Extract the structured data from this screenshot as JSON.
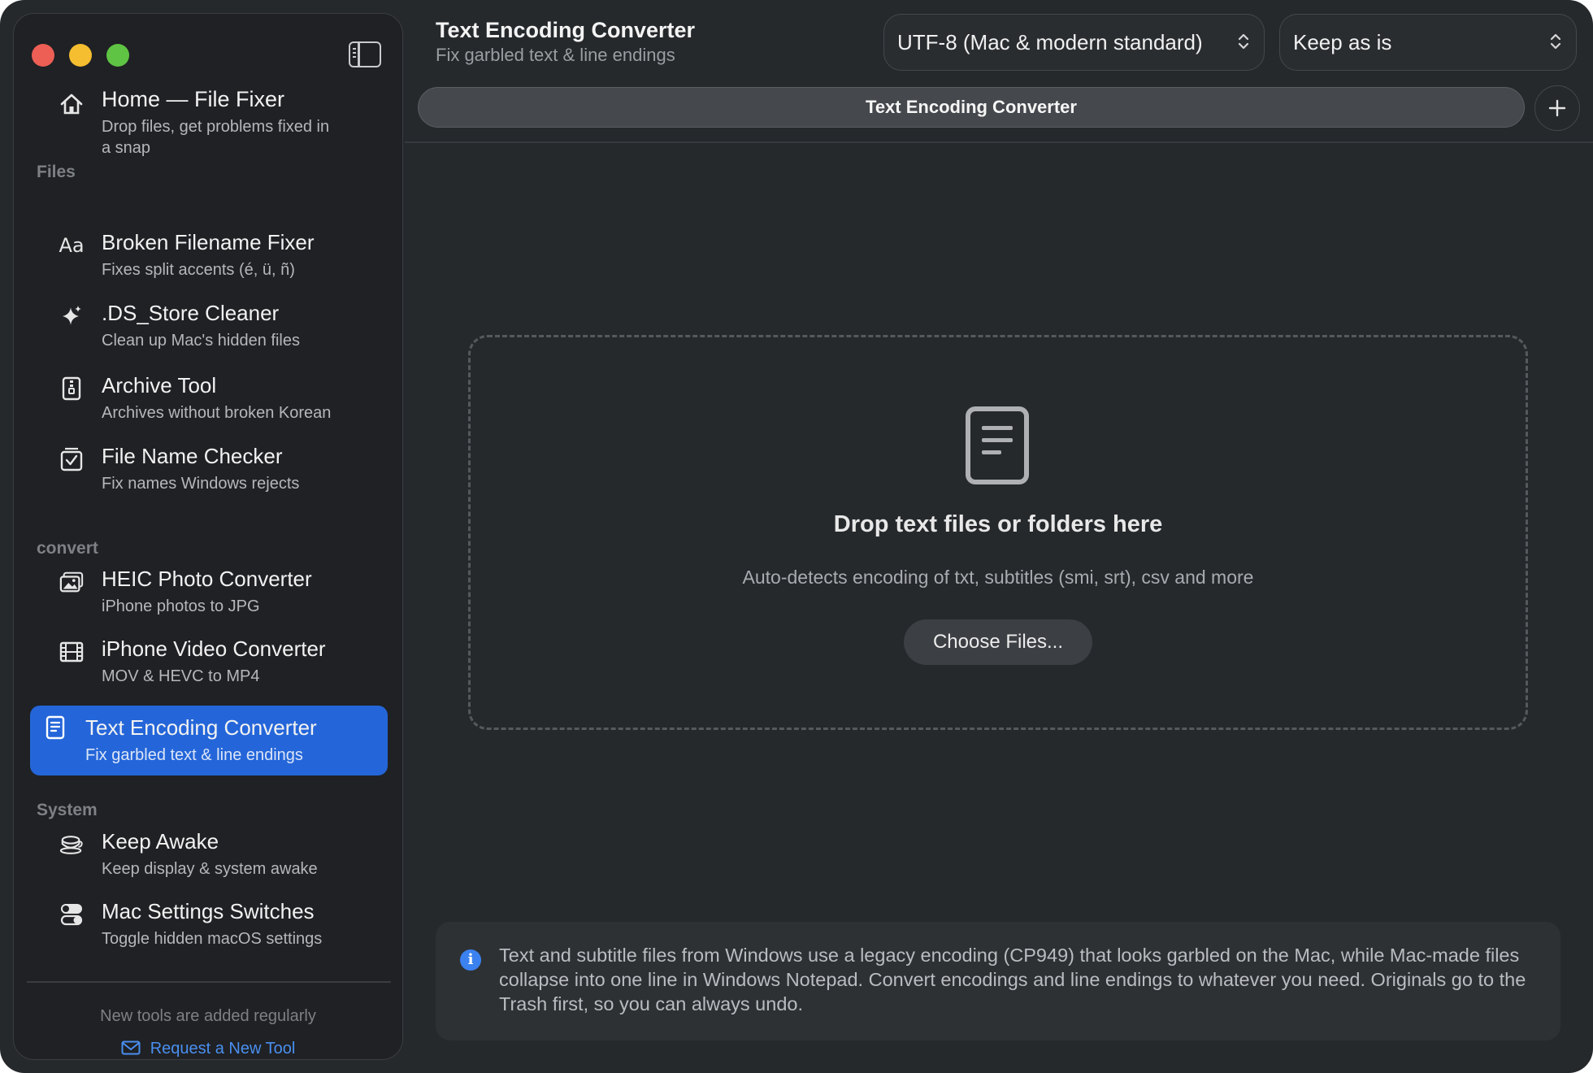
{
  "sidebar": {
    "home": {
      "title": "Home — File Fixer",
      "subtitle_line1": "Drop files, get problems fixed in",
      "subtitle_line2": "a snap"
    },
    "sections": {
      "files": "Files",
      "convert": "convert",
      "system": "System"
    },
    "items": [
      {
        "title": "Broken Filename Fixer",
        "subtitle": "Fixes split accents (é, ü, ñ)",
        "icon": "text-aa-icon"
      },
      {
        "title": ".DS_Store Cleaner",
        "subtitle": "Clean up Mac's hidden files",
        "icon": "sparkle-icon"
      },
      {
        "title": "Archive Tool",
        "subtitle": "Archives without broken Korean",
        "icon": "archive-icon"
      },
      {
        "title": "File Name Checker",
        "subtitle": "Fix names Windows rejects",
        "icon": "checklist-icon"
      },
      {
        "title": "HEIC Photo Converter",
        "subtitle": "iPhone photos to JPG",
        "icon": "photos-icon"
      },
      {
        "title": "iPhone Video Converter",
        "subtitle": "MOV & HEVC to MP4",
        "icon": "film-icon"
      },
      {
        "title": "Text Encoding Converter",
        "subtitle": "Fix garbled text & line endings",
        "icon": "document-icon",
        "active": true
      },
      {
        "title": "Keep Awake",
        "subtitle": "Keep display & system awake",
        "icon": "coffee-cup-icon"
      },
      {
        "title": "Mac Settings Switches",
        "subtitle": "Toggle hidden macOS settings",
        "icon": "toggles-icon"
      }
    ],
    "footer_note": "New tools are added regularly",
    "request_link": "Request a New Tool"
  },
  "header": {
    "title": "Text Encoding Converter",
    "subtitle": "Fix garbled text & line endings",
    "encoding_select": "UTF-8 (Mac & modern standard)",
    "line_ending_select": "Keep as is"
  },
  "tab": {
    "label": "Text Encoding Converter"
  },
  "drop_zone": {
    "title": "Drop text files or folders here",
    "subtitle": "Auto-detects encoding of txt, subtitles (smi, srt), csv and more",
    "button": "Choose Files..."
  },
  "info": {
    "text": "Text and subtitle files from Windows use a legacy encoding (CP949) that looks garbled on the Mac, while Mac-made files collapse into one line in Windows Notepad. Convert encodings and line endings to whatever you need. Originals go to the Trash first, so you can always undo."
  },
  "colors": {
    "accent": "#2466d9",
    "link": "#4a8ff0",
    "info_icon": "#3b82f0"
  }
}
